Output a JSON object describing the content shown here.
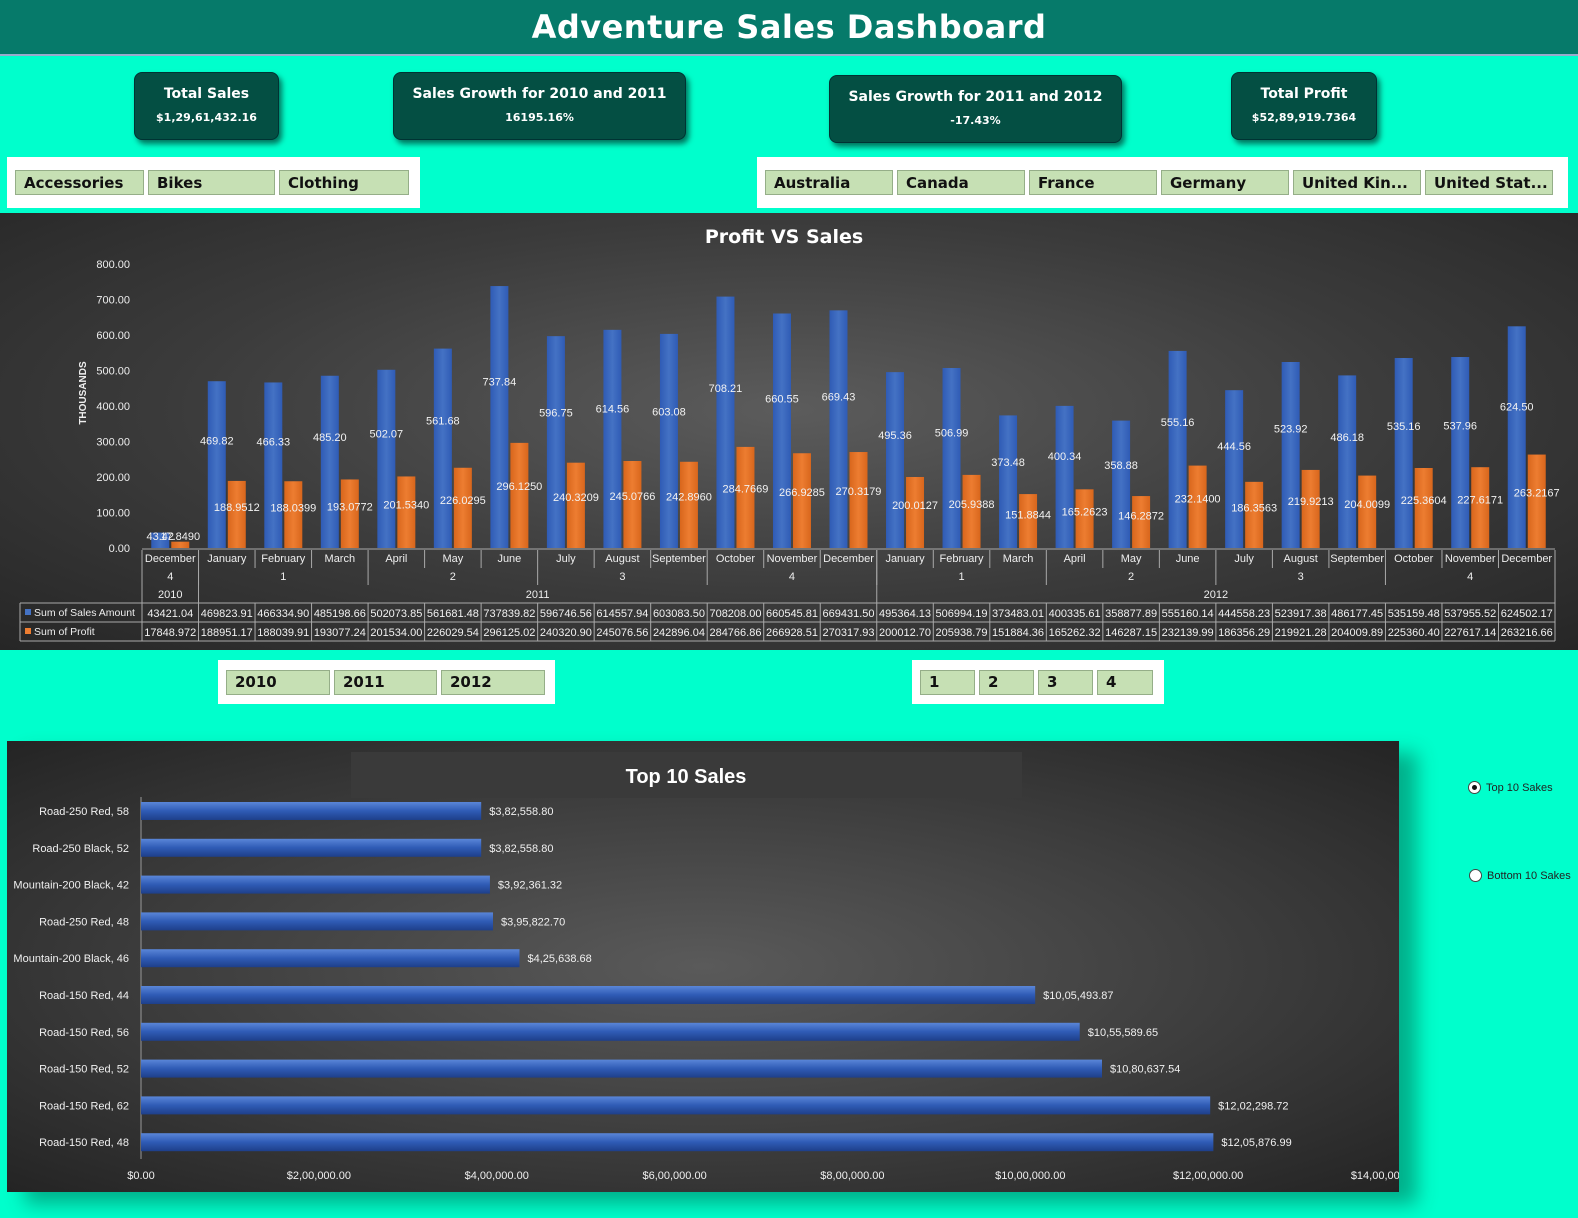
{
  "dashboard": {
    "title": "Adventure Sales Dashboard"
  },
  "kpis": {
    "total_sales": {
      "label": "Total Sales",
      "value": "$1,29,61,432.16"
    },
    "growth_2010_2011": {
      "label": "Sales Growth for 2010 and 2011",
      "value": "16195.16%"
    },
    "growth_2011_2012": {
      "label": "Sales Growth for 2011 and 2012",
      "value": "-17.43%"
    },
    "total_profit": {
      "label": "Total Profit",
      "value": "$52,89,919.7364"
    }
  },
  "category_slicer": {
    "items": [
      "Accessories",
      "Bikes",
      "Clothing"
    ]
  },
  "country_slicer": {
    "items": [
      "Australia",
      "Canada",
      "France",
      "Germany",
      "United Kin...",
      "United Stat..."
    ]
  },
  "year_slicer": {
    "items": [
      "2010",
      "2011",
      "2012"
    ]
  },
  "quarter_slicer": {
    "items": [
      "1",
      "2",
      "3",
      "4"
    ]
  },
  "options": {
    "top10": "Top 10 Sakes",
    "bottom10": "Bottom 10 Sakes",
    "selected": "top10"
  },
  "colors": {
    "sales": "#4472C4",
    "profit": "#ED7D31",
    "accent": "#00FFCC",
    "header": "#067A6A"
  },
  "chart_data": [
    {
      "type": "bar",
      "title": "Profit VS Sales",
      "ylabel": "THOUSANDS",
      "ylim": [
        0,
        800
      ],
      "yticks": [
        "0.00",
        "100.00",
        "200.00",
        "300.00",
        "400.00",
        "500.00",
        "600.00",
        "700.00",
        "800.00"
      ],
      "grid": false,
      "categories": [
        "December",
        "January",
        "February",
        "March",
        "April",
        "May",
        "June",
        "July",
        "August",
        "September",
        "October",
        "November",
        "December",
        "January",
        "February",
        "March",
        "April",
        "May",
        "June",
        "July",
        "August",
        "September",
        "October",
        "November",
        "December"
      ],
      "quarters": [
        {
          "label": "4",
          "count": 1
        },
        {
          "label": "1",
          "count": 3
        },
        {
          "label": "2",
          "count": 3
        },
        {
          "label": "3",
          "count": 3
        },
        {
          "label": "4",
          "count": 3
        },
        {
          "label": "1",
          "count": 3
        },
        {
          "label": "2",
          "count": 3
        },
        {
          "label": "3",
          "count": 3
        },
        {
          "label": "4",
          "count": 3
        }
      ],
      "years": [
        {
          "label": "2010",
          "count": 1
        },
        {
          "label": "2011",
          "count": 12
        },
        {
          "label": "2012",
          "count": 12
        }
      ],
      "series": [
        {
          "name": "Sum of Sales Amount",
          "values": [
            43.42,
            469.82,
            466.33,
            485.2,
            502.07,
            561.68,
            737.84,
            596.75,
            614.56,
            603.08,
            708.21,
            660.55,
            669.43,
            495.36,
            506.99,
            373.48,
            400.34,
            358.88,
            555.16,
            444.56,
            523.92,
            486.18,
            535.16,
            537.96,
            624.5
          ],
          "labels": [
            "43.42",
            "469.82",
            "466.33",
            "485.20",
            "502.07",
            "561.68",
            "737.84",
            "596.75",
            "614.56",
            "603.08",
            "708.21",
            "660.55",
            "669.43",
            "495.36",
            "506.99",
            "373.48",
            "400.34",
            "358.88",
            "555.16",
            "444.56",
            "523.92",
            "486.18",
            "535.16",
            "537.96",
            "624.50"
          ],
          "table": [
            "43421.04",
            "469823.91",
            "466334.90",
            "485198.66",
            "502073.85",
            "561681.48",
            "737839.82",
            "596746.56",
            "614557.94",
            "603083.50",
            "708208.00",
            "660545.81",
            "669431.50",
            "495364.13",
            "506994.19",
            "373483.01",
            "400335.61",
            "358877.89",
            "555160.14",
            "444558.23",
            "523917.38",
            "486177.45",
            "535159.48",
            "537955.52",
            "624502.17"
          ]
        },
        {
          "name": "Sum of Profit",
          "values": [
            17.849,
            188.951,
            188.04,
            193.077,
            201.534,
            226.03,
            296.125,
            240.321,
            245.077,
            242.896,
            284.767,
            266.929,
            270.318,
            200.013,
            205.939,
            151.884,
            165.262,
            146.287,
            232.14,
            186.356,
            219.921,
            204.01,
            225.36,
            227.617,
            263.217
          ],
          "labels": [
            "17.8490",
            "188.9512",
            "188.0399",
            "193.0772",
            "201.5340",
            "226.0295",
            "296.1250",
            "240.3209",
            "245.0766",
            "242.8960",
            "284.7669",
            "266.9285",
            "270.3179",
            "200.0127",
            "205.9388",
            "151.8844",
            "165.2623",
            "146.2872",
            "232.1400",
            "186.3563",
            "219.9213",
            "204.0099",
            "225.3604",
            "227.6171",
            "263.2167"
          ],
          "table": [
            "17848.972",
            "188951.17",
            "188039.91",
            "193077.24",
            "201534.00",
            "226029.54",
            "296125.02",
            "240320.90",
            "245076.56",
            "242896.04",
            "284766.86",
            "266928.51",
            "270317.93",
            "200012.70",
            "205938.79",
            "151884.36",
            "165262.32",
            "146287.15",
            "232139.99",
            "186356.29",
            "219921.28",
            "204009.89",
            "225360.40",
            "227617.14",
            "263216.66"
          ]
        }
      ]
    },
    {
      "type": "bar",
      "orientation": "horizontal",
      "title": "Top 10 Sales",
      "xlim": [
        0,
        1400000
      ],
      "xticks": [
        "$0.00",
        "$2,00,000.00",
        "$4,00,000.00",
        "$6,00,000.00",
        "$8,00,000.00",
        "$10,00,000.00",
        "$12,00,000.00",
        "$14,00,000.00"
      ],
      "categories": [
        "Road-250 Red, 58",
        "Road-250 Black, 52",
        "Mountain-200 Black, 42",
        "Road-250 Red, 48",
        "Mountain-200 Black, 46",
        "Road-150 Red, 44",
        "Road-150 Red, 56",
        "Road-150 Red, 52",
        "Road-150 Red, 62",
        "Road-150 Red, 48"
      ],
      "values": [
        382558.8,
        382558.8,
        392361.32,
        395822.7,
        425638.68,
        1005493.87,
        1055589.65,
        1080637.54,
        1202298.72,
        1205876.99
      ],
      "labels": [
        "$3,82,558.80",
        "$3,82,558.80",
        "$3,92,361.32",
        "$3,95,822.70",
        "$4,25,638.68",
        "$10,05,493.87",
        "$10,55,589.65",
        "$10,80,637.54",
        "$12,02,298.72",
        "$12,05,876.99"
      ]
    }
  ]
}
